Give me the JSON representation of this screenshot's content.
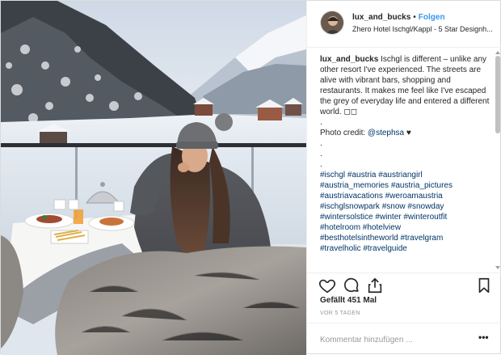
{
  "post": {
    "username": "lux_and_bucks",
    "separator": "•",
    "follow_label": "Folgen",
    "location": "Zhero Hotel Ischgl/Kappl - 5 Star Designh..."
  },
  "caption": {
    "username": "lux_and_bucks",
    "text": "Ischgl is different – unlike any other resort I've experienced. The streets are alive with vibrant bars, shopping and restaurants. It makes me feel like I've escaped the grey of everyday life and entered a different world. ◻◻",
    "dot": ".",
    "credit_prefix": "Photo credit: ",
    "credit_handle": "@stephsa",
    "credit_emoji": "♥",
    "hashtags": [
      "#ischgl #austria #austriangirl",
      "#austria_memories #austria_pictures",
      "#austriavacations #weroamaustria",
      "#ischglsnowpark #snow #snowday",
      "#wintersolstice #winter #winteroutfit",
      "#hotelroom #hotelview",
      "#besthotelsintheworld #travelgram",
      "#travelholic #travelguide"
    ]
  },
  "actions": {
    "likes": "Gefällt 451 Mal",
    "time_ago": "VOR 5 TAGEN"
  },
  "comment": {
    "placeholder": "Kommentar hinzufügen ...",
    "more": "•••"
  },
  "icons": {
    "like": "heart-icon",
    "comment": "comment-icon",
    "share": "share-icon",
    "save": "bookmark-icon"
  }
}
